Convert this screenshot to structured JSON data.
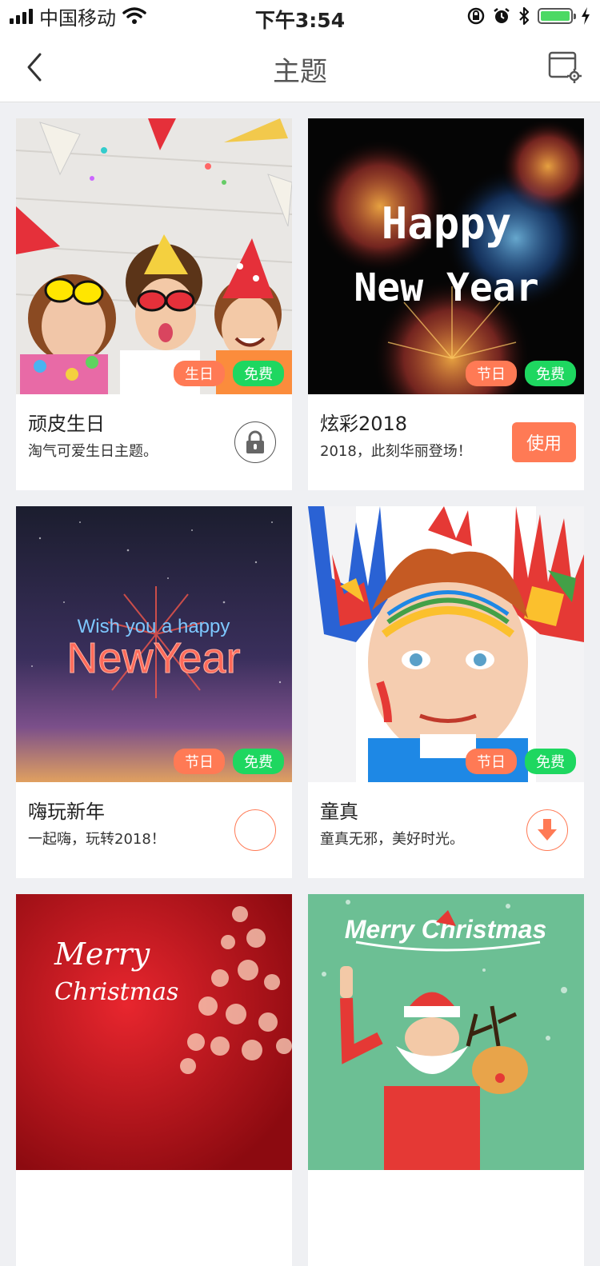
{
  "status_bar": {
    "carrier": "中国移动",
    "time": "下午3:54"
  },
  "nav": {
    "title": "主题"
  },
  "colors": {
    "accent_orange": "#ff7a55",
    "free_green": "#1ed760"
  },
  "themes": [
    {
      "title": "顽皮生日",
      "desc": "淘气可爱生日主题。",
      "tag1": "生日",
      "tag2": "免费",
      "action": "lock-icon"
    },
    {
      "title": "炫彩2018",
      "desc": "2018，此刻华丽登场！",
      "tag1": "节日",
      "tag2": "免费",
      "action_label": "使用",
      "thumb_text1": "Happy",
      "thumb_text2": "New Year"
    },
    {
      "title": "嗨玩新年",
      "desc": "一起嗨，玩转2018！",
      "tag1": "节日",
      "tag2": "免费",
      "action": "progress-ring",
      "thumb_text1": "Wish you a happy",
      "thumb_text2": "NewYear"
    },
    {
      "title": "童真",
      "desc": "童真无邪，美好时光。",
      "tag1": "节日",
      "tag2": "免费",
      "action": "download-icon"
    },
    {
      "thumb_text1": "Merry",
      "thumb_text2": "Christmas"
    },
    {
      "thumb_text1": "Merry Christmas"
    }
  ]
}
